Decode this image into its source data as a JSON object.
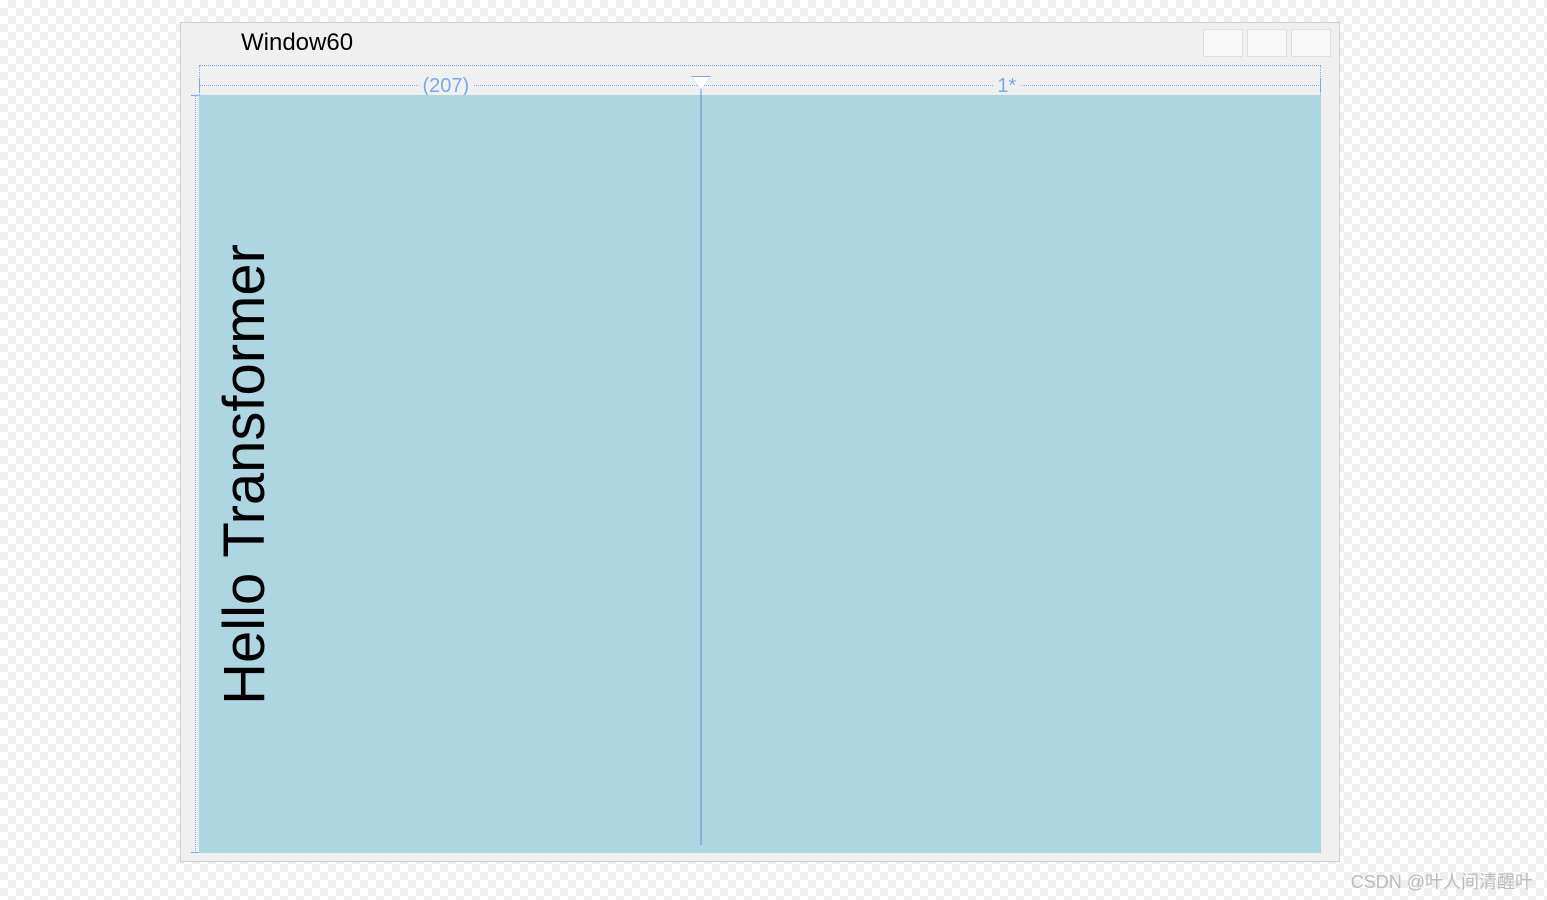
{
  "window": {
    "title": "Window60"
  },
  "designer": {
    "columns": [
      {
        "label": "(207)"
      },
      {
        "label": "1*"
      }
    ]
  },
  "content": {
    "text_block": "Hello Transformer"
  },
  "watermark": "CSDN @叶人间清醒叶"
}
